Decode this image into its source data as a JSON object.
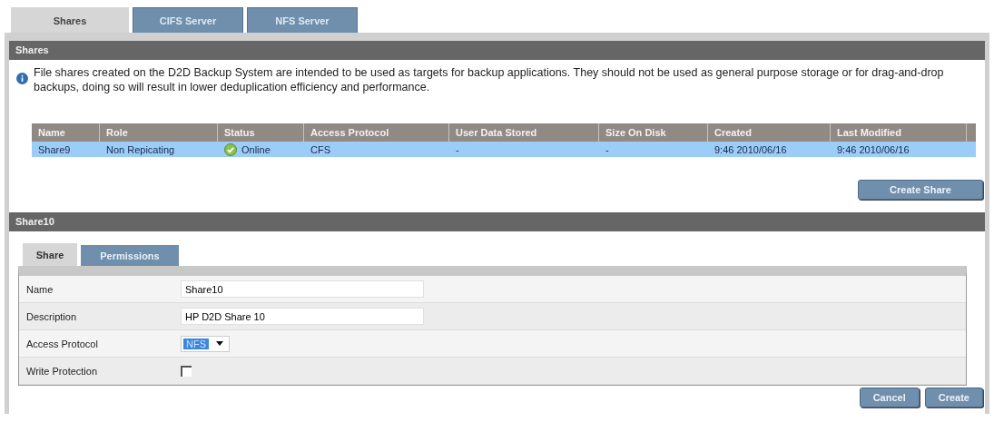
{
  "tabs": [
    {
      "label": "Shares",
      "selected": true
    },
    {
      "label": "CIFS Server",
      "selected": false
    },
    {
      "label": "NFS Server",
      "selected": false
    }
  ],
  "shares_panel": {
    "title": "Shares",
    "info": "File shares created on the D2D Backup System are intended to be used as targets for backup applications. They should not be used as general purpose storage or for drag-and-drop backups, doing so will result in lower deduplication efficiency and performance."
  },
  "table": {
    "columns": [
      "Name",
      "Role",
      "Status",
      "Access Protocol",
      "User Data Stored",
      "Size On Disk",
      "Created",
      "Last Modified"
    ],
    "rows": [
      {
        "selected": true,
        "status_ok": true,
        "cells": [
          "Share9",
          "Non Repicating",
          "Online",
          "CFS",
          "-",
          "-",
          "9:46 2010/06/16",
          "9:46 2010/06/16"
        ]
      }
    ]
  },
  "create_share_button": "Create Share",
  "detail_panel": {
    "title": "Share10",
    "tabs": [
      {
        "label": "Share",
        "selected": true
      },
      {
        "label": "Permissions",
        "selected": false
      }
    ],
    "fields": [
      {
        "kind": "text",
        "label": "Name",
        "value": "Share10"
      },
      {
        "kind": "text",
        "label": "Description",
        "value": "HP D2D Share 10"
      },
      {
        "kind": "select",
        "label": "Access Protocol",
        "value": "NFS"
      },
      {
        "kind": "checkbox",
        "label": "Write Protection",
        "checked": false
      }
    ]
  },
  "buttons": [
    "Cancel",
    "Create"
  ]
}
